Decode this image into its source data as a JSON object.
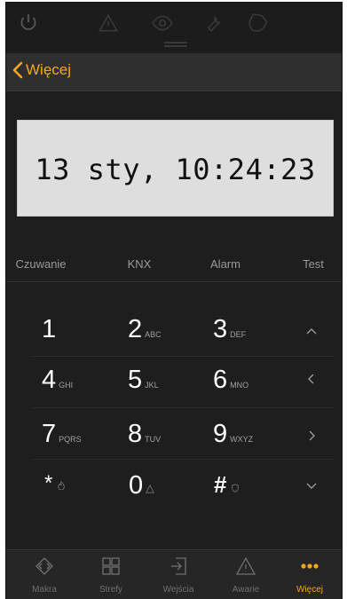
{
  "nav": {
    "back_label": "Więcej"
  },
  "display": {
    "text": "13 sty, 10:24:23"
  },
  "functions": [
    "Czuwanie",
    "KNX",
    "Alarm",
    "Test"
  ],
  "keypad": [
    {
      "digit": "1",
      "sub": ""
    },
    {
      "digit": "2",
      "sub": "ABC"
    },
    {
      "digit": "3",
      "sub": "DEF"
    },
    {
      "digit": "4",
      "sub": "GHI"
    },
    {
      "digit": "5",
      "sub": "JKL"
    },
    {
      "digit": "6",
      "sub": "MNO"
    },
    {
      "digit": "7",
      "sub": "PQRS"
    },
    {
      "digit": "8",
      "sub": "TUV"
    },
    {
      "digit": "9",
      "sub": "WXYZ"
    },
    {
      "digit": "*",
      "sub": ""
    },
    {
      "digit": "0",
      "sub": ""
    },
    {
      "digit": "#",
      "sub": ""
    }
  ],
  "tabs": [
    {
      "label": "Makra",
      "icon": "macro-icon"
    },
    {
      "label": "Strefy",
      "icon": "zones-icon"
    },
    {
      "label": "Wejścia",
      "icon": "inputs-icon"
    },
    {
      "label": "Awarie",
      "icon": "warning-icon"
    },
    {
      "label": "Więcej",
      "icon": "more-icon"
    }
  ],
  "colors": {
    "accent": "#f5a623",
    "background": "#1e1e1e",
    "display": "#dedede"
  }
}
